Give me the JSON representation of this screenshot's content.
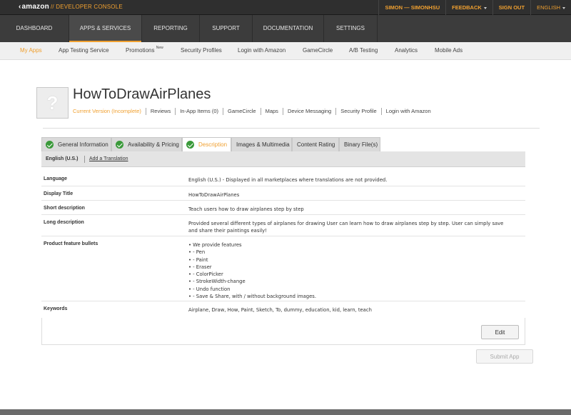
{
  "topbar": {
    "brand": "amazon",
    "console_label": "// DEVELOPER CONSOLE",
    "user": "SIMON — SIMONHSU",
    "feedback": "FEEDBACK",
    "signout": "SIGN OUT",
    "language": "ENGLISH"
  },
  "mainnav": [
    "DASHBOARD",
    "APPS & SERVICES",
    "REPORTING",
    "SUPPORT",
    "DOCUMENTATION",
    "SETTINGS"
  ],
  "subnav": {
    "my_apps": "My Apps",
    "app_testing": "App Testing Service",
    "promotions": "Promotions",
    "promotions_badge": "New",
    "security_profiles": "Security Profiles",
    "login_with_amazon": "Login with Amazon",
    "gamecircle": "GameCircle",
    "ab_testing": "A/B Testing",
    "analytics": "Analytics",
    "mobile_ads": "Mobile Ads"
  },
  "app": {
    "icon_placeholder": "?",
    "title": "HowToDrawAirPlanes",
    "links": [
      "Current Version (Incomplete)",
      "Reviews",
      "In-App Items (0)",
      "GameCircle",
      "Maps",
      "Device Messaging",
      "Security Profile",
      "Login with Amazon"
    ]
  },
  "tabs": [
    "General Information",
    "Availability & Pricing",
    "Description",
    "Images & Multimedia",
    "Content Rating",
    "Binary File(s)"
  ],
  "langbar": {
    "current": "English (U.S.)",
    "add": "Add a Translation"
  },
  "details": {
    "language": {
      "label": "Language",
      "value": "English (U.S.) - Displayed in all marketplaces where translations are not provided."
    },
    "display_title": {
      "label": "Display Title",
      "value": "HowToDrawAirPlanes"
    },
    "short_desc": {
      "label": "Short description",
      "value": "Teach users how to draw airplanes step by step"
    },
    "long_desc": {
      "label": "Long description",
      "line1": "Provided several different types of airplanes for drawing User can learn how to draw airplanes step by step. User can simply save",
      "line2": "and share their paintings easily!"
    },
    "bullets": {
      "label": "Product feature bullets",
      "items": [
        "• We provide features",
        "• - Pen",
        "• - Paint",
        "• - Eraser",
        "• - ColorPicker",
        "• - StrokeWidth-change",
        "• - Undo function",
        "• - Save & Share, with / without background images."
      ]
    },
    "keywords": {
      "label": "Keywords",
      "value": "Airplane, Draw, How, Paint, Sketch, To, dummy, education, kid, learn, teach"
    }
  },
  "buttons": {
    "edit": "Edit",
    "submit": "Submit App"
  },
  "colors": {
    "accent": "#f0a030",
    "check": "#3a9a3a",
    "topbar": "#2f2f2f",
    "nav": "#3c3c3c"
  }
}
